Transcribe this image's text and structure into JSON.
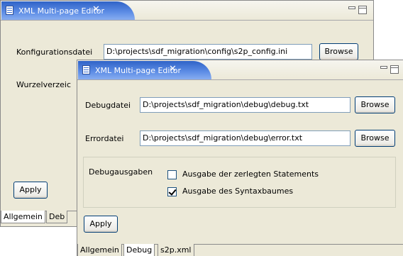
{
  "back_editor": {
    "tab_title": "XML Multi-page Editor",
    "close_glyph": "✕",
    "config_label": "Konfigurationsdatei",
    "config_value": "D:\\projects\\sdf_migration\\config\\s2p_config.ini",
    "browse_label": "Browse",
    "root_label": "Wurzelverzeic",
    "apply_label": "Apply",
    "bottom_tabs": [
      "Allgemein",
      "Deb"
    ]
  },
  "front_editor": {
    "tab_title": "XML Multi-page Editor",
    "close_glyph": "✕",
    "debug_label": "Debugdatei",
    "debug_value": "D:\\projects\\sdf_migration\\debug\\debug.txt",
    "error_label": "Errordatei",
    "error_value": "D:\\projects\\sdf_migration\\debug\\error.txt",
    "browse_label": "Browse",
    "group_label": "Debugausgaben",
    "checkboxes": [
      {
        "label": "Ausgabe der zerlegten Statements",
        "checked": false
      },
      {
        "label": "Ausgabe des Syntaxbaumes",
        "checked": true
      }
    ],
    "apply_label": "Apply",
    "bottom_tabs": [
      "Allgemein",
      "Debug",
      "s2p.xml"
    ]
  },
  "colors": {
    "tab_active": "#3b6ed3",
    "panel_bg": "#ece9d8",
    "button_border": "#003c74"
  }
}
